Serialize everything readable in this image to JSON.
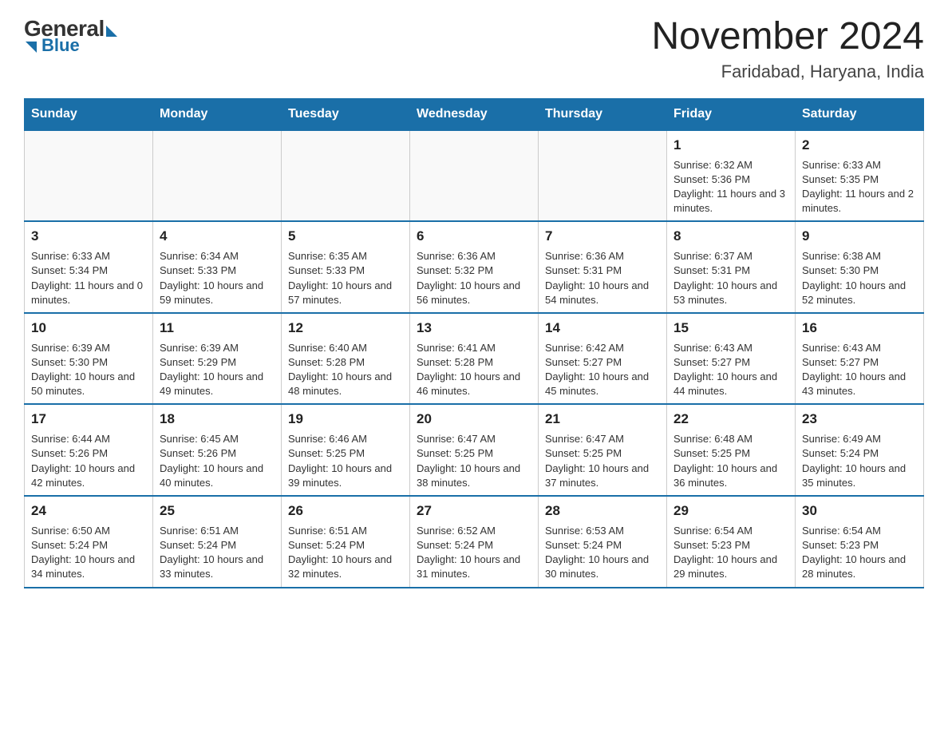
{
  "header": {
    "logo_general": "General",
    "logo_blue": "Blue",
    "title": "November 2024",
    "subtitle": "Faridabad, Haryana, India"
  },
  "days_of_week": [
    "Sunday",
    "Monday",
    "Tuesday",
    "Wednesday",
    "Thursday",
    "Friday",
    "Saturday"
  ],
  "weeks": [
    [
      {
        "day": "",
        "info": ""
      },
      {
        "day": "",
        "info": ""
      },
      {
        "day": "",
        "info": ""
      },
      {
        "day": "",
        "info": ""
      },
      {
        "day": "",
        "info": ""
      },
      {
        "day": "1",
        "info": "Sunrise: 6:32 AM\nSunset: 5:36 PM\nDaylight: 11 hours and 3 minutes."
      },
      {
        "day": "2",
        "info": "Sunrise: 6:33 AM\nSunset: 5:35 PM\nDaylight: 11 hours and 2 minutes."
      }
    ],
    [
      {
        "day": "3",
        "info": "Sunrise: 6:33 AM\nSunset: 5:34 PM\nDaylight: 11 hours and 0 minutes."
      },
      {
        "day": "4",
        "info": "Sunrise: 6:34 AM\nSunset: 5:33 PM\nDaylight: 10 hours and 59 minutes."
      },
      {
        "day": "5",
        "info": "Sunrise: 6:35 AM\nSunset: 5:33 PM\nDaylight: 10 hours and 57 minutes."
      },
      {
        "day": "6",
        "info": "Sunrise: 6:36 AM\nSunset: 5:32 PM\nDaylight: 10 hours and 56 minutes."
      },
      {
        "day": "7",
        "info": "Sunrise: 6:36 AM\nSunset: 5:31 PM\nDaylight: 10 hours and 54 minutes."
      },
      {
        "day": "8",
        "info": "Sunrise: 6:37 AM\nSunset: 5:31 PM\nDaylight: 10 hours and 53 minutes."
      },
      {
        "day": "9",
        "info": "Sunrise: 6:38 AM\nSunset: 5:30 PM\nDaylight: 10 hours and 52 minutes."
      }
    ],
    [
      {
        "day": "10",
        "info": "Sunrise: 6:39 AM\nSunset: 5:30 PM\nDaylight: 10 hours and 50 minutes."
      },
      {
        "day": "11",
        "info": "Sunrise: 6:39 AM\nSunset: 5:29 PM\nDaylight: 10 hours and 49 minutes."
      },
      {
        "day": "12",
        "info": "Sunrise: 6:40 AM\nSunset: 5:28 PM\nDaylight: 10 hours and 48 minutes."
      },
      {
        "day": "13",
        "info": "Sunrise: 6:41 AM\nSunset: 5:28 PM\nDaylight: 10 hours and 46 minutes."
      },
      {
        "day": "14",
        "info": "Sunrise: 6:42 AM\nSunset: 5:27 PM\nDaylight: 10 hours and 45 minutes."
      },
      {
        "day": "15",
        "info": "Sunrise: 6:43 AM\nSunset: 5:27 PM\nDaylight: 10 hours and 44 minutes."
      },
      {
        "day": "16",
        "info": "Sunrise: 6:43 AM\nSunset: 5:27 PM\nDaylight: 10 hours and 43 minutes."
      }
    ],
    [
      {
        "day": "17",
        "info": "Sunrise: 6:44 AM\nSunset: 5:26 PM\nDaylight: 10 hours and 42 minutes."
      },
      {
        "day": "18",
        "info": "Sunrise: 6:45 AM\nSunset: 5:26 PM\nDaylight: 10 hours and 40 minutes."
      },
      {
        "day": "19",
        "info": "Sunrise: 6:46 AM\nSunset: 5:25 PM\nDaylight: 10 hours and 39 minutes."
      },
      {
        "day": "20",
        "info": "Sunrise: 6:47 AM\nSunset: 5:25 PM\nDaylight: 10 hours and 38 minutes."
      },
      {
        "day": "21",
        "info": "Sunrise: 6:47 AM\nSunset: 5:25 PM\nDaylight: 10 hours and 37 minutes."
      },
      {
        "day": "22",
        "info": "Sunrise: 6:48 AM\nSunset: 5:25 PM\nDaylight: 10 hours and 36 minutes."
      },
      {
        "day": "23",
        "info": "Sunrise: 6:49 AM\nSunset: 5:24 PM\nDaylight: 10 hours and 35 minutes."
      }
    ],
    [
      {
        "day": "24",
        "info": "Sunrise: 6:50 AM\nSunset: 5:24 PM\nDaylight: 10 hours and 34 minutes."
      },
      {
        "day": "25",
        "info": "Sunrise: 6:51 AM\nSunset: 5:24 PM\nDaylight: 10 hours and 33 minutes."
      },
      {
        "day": "26",
        "info": "Sunrise: 6:51 AM\nSunset: 5:24 PM\nDaylight: 10 hours and 32 minutes."
      },
      {
        "day": "27",
        "info": "Sunrise: 6:52 AM\nSunset: 5:24 PM\nDaylight: 10 hours and 31 minutes."
      },
      {
        "day": "28",
        "info": "Sunrise: 6:53 AM\nSunset: 5:24 PM\nDaylight: 10 hours and 30 minutes."
      },
      {
        "day": "29",
        "info": "Sunrise: 6:54 AM\nSunset: 5:23 PM\nDaylight: 10 hours and 29 minutes."
      },
      {
        "day": "30",
        "info": "Sunrise: 6:54 AM\nSunset: 5:23 PM\nDaylight: 10 hours and 28 minutes."
      }
    ]
  ]
}
